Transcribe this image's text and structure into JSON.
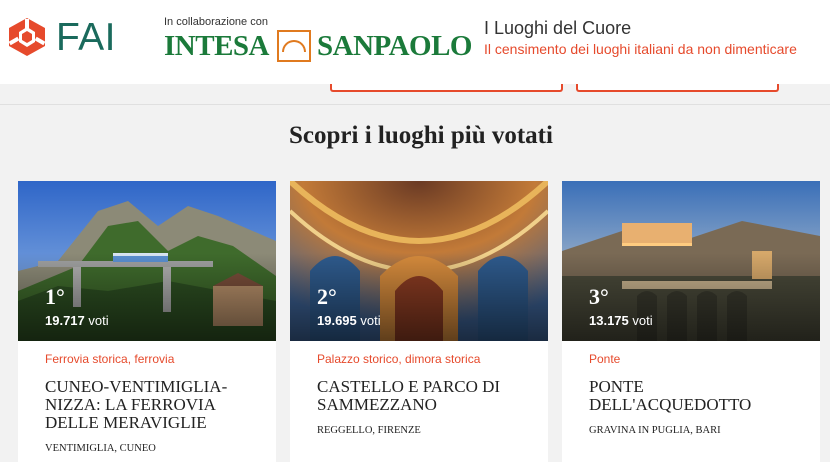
{
  "header": {
    "logo_text": "FAI",
    "collab_label": "In collaborazione con",
    "partner_word_left": "INTESA",
    "partner_word_right": "SANPAOLO",
    "campaign_title": "I Luoghi del Cuore",
    "campaign_subtitle": "Il censimento dei luoghi italiani da non dimenticare"
  },
  "colors": {
    "accent": "#e64a2c",
    "fai_green": "#1a6a5c",
    "intesa_green": "#1b7a3a",
    "intesa_orange": "#e07a1f"
  },
  "section": {
    "title": "Scopri i luoghi più votati"
  },
  "cards": [
    {
      "rank": "1°",
      "votes": "19.717",
      "votes_unit": "voti",
      "category": "Ferrovia storica, ferrovia",
      "name": "CUNEO-VENTIMIGLIA-NIZZA: LA FERROVIA DELLE MERAVIGLIE",
      "place": "VENTIMIGLIA, CUNEO"
    },
    {
      "rank": "2°",
      "votes": "19.695",
      "votes_unit": "voti",
      "category": "Palazzo storico, dimora storica",
      "name": "CASTELLO E PARCO DI SAMMEZZANO",
      "place": "REGGELLO, FIRENZE"
    },
    {
      "rank": "3°",
      "votes": "13.175",
      "votes_unit": "voti",
      "category": "Ponte",
      "name": "PONTE DELL'ACQUEDOTTO",
      "place": "GRAVINA IN PUGLIA, BARI"
    }
  ]
}
